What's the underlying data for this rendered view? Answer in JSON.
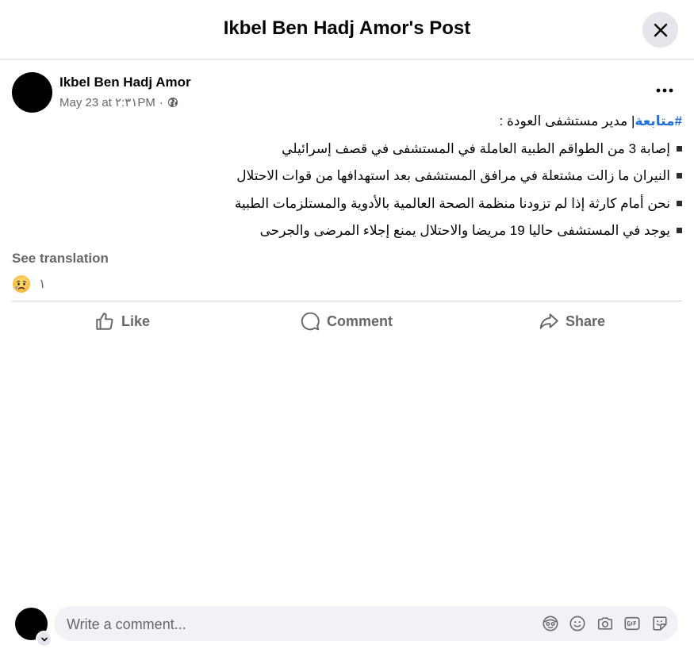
{
  "header": {
    "title": "Ikbel Ben Hadj Amor's Post",
    "close_icon": "close-icon"
  },
  "post": {
    "author": "Ikbel Ben Hadj Amor",
    "date": "May 23 at ٢:٣١PM",
    "separator": "·",
    "privacy_icon": "globe-icon",
    "more_icon": "more-options-icon",
    "hashtag": "#متابعة",
    "intro": "| مدير مستشفى العودة :",
    "bullets": [
      "إصابة 3 من الطواقم الطبية العاملة في المستشفى في قصف إسرائيلي",
      "النيران ما زالت مشتعلة في مرافق المستشفى بعد استهدافها من قوات الاحتلال",
      "نحن أمام كارثة إذا لم تزودنا منظمة الصحة العالمية بالأدوية والمستلزمات الطبية",
      "يوجد في المستشفى حاليا 19 مريضا والاحتلال يمنع إجلاء المرضى والجرحى"
    ],
    "see_translation": "See translation",
    "reaction_icon": "sad-emoji-icon",
    "reaction_count": "١"
  },
  "actions": {
    "like": "Like",
    "comment": "Comment",
    "share": "Share"
  },
  "comment_box": {
    "placeholder": "Write a comment...",
    "icons": [
      "avatar-sticker-icon",
      "emoji-icon",
      "camera-icon",
      "gif-icon",
      "sticker-icon"
    ]
  },
  "colors": {
    "hashtag": "#216fdb",
    "secondary_text": "#65676b",
    "input_bg": "#f0f2f5"
  }
}
